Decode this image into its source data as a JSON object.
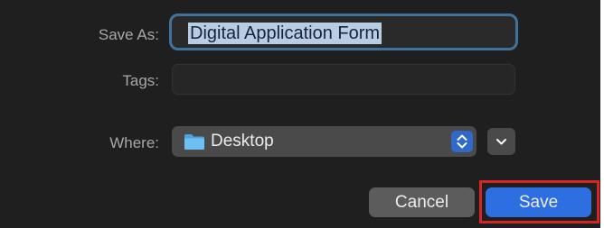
{
  "dialog": {
    "save_as_label": "Save As:",
    "file_name": "Digital Application Form",
    "tags_label": "Tags:",
    "tags_value": "",
    "where_label": "Where:",
    "where_value": "Desktop",
    "where_icon": "folder-icon",
    "stepper_icon": "chevron-up-down-icon",
    "expand_icon": "chevron-down-icon",
    "cancel_label": "Cancel",
    "save_label": "Save"
  },
  "colors": {
    "background": "#1f1f1f",
    "accent": "#2d6fe0",
    "focus_ring": "#41729c",
    "highlight_box": "#d42424"
  }
}
